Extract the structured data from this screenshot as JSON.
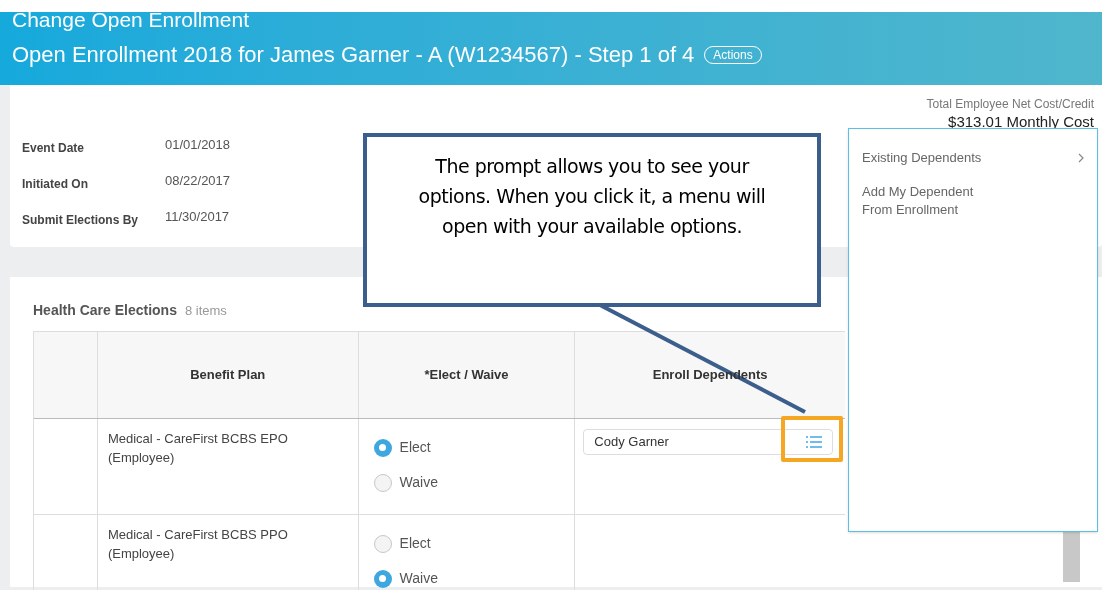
{
  "header": {
    "title": "Change Open Enrollment",
    "subtitle": "Open Enrollment 2018 for James Garner - A (W1234567) - Step 1 of 4",
    "actions_button": "Actions"
  },
  "summary": {
    "cost_label": "Total Employee Net Cost/Credit",
    "cost_value": "$313.01 Monthly Cost",
    "fields": [
      {
        "label": "Event Date",
        "value": "01/01/2018"
      },
      {
        "label": "Initiated On",
        "value": "08/22/2017"
      },
      {
        "label": "Submit Elections By",
        "value": "11/30/2017"
      }
    ]
  },
  "section": {
    "title": "Health Care Elections",
    "count": "8 items"
  },
  "table": {
    "columns": [
      "Benefit Plan",
      "*Elect / Waive",
      "Enroll Dependents"
    ],
    "rows": [
      {
        "plan": "Medical - CareFirst BCBS EPO (Employee)",
        "options": [
          {
            "label": "Elect",
            "selected": true
          },
          {
            "label": "Waive",
            "selected": false
          }
        ],
        "dependent": "Cody Garner"
      },
      {
        "plan": "Medical - CareFirst BCBS PPO (Employee)",
        "options": [
          {
            "label": "Elect",
            "selected": false
          },
          {
            "label": "Waive",
            "selected": true
          }
        ]
      }
    ]
  },
  "callout": {
    "text": "The prompt allows you to see your options. When you click it, a menu will open with your available options."
  },
  "menu": {
    "items": [
      {
        "label": "Existing Dependents",
        "submenu": true
      },
      {
        "label": "Add My Dependent From Enrollment",
        "submenu": false
      }
    ]
  }
}
